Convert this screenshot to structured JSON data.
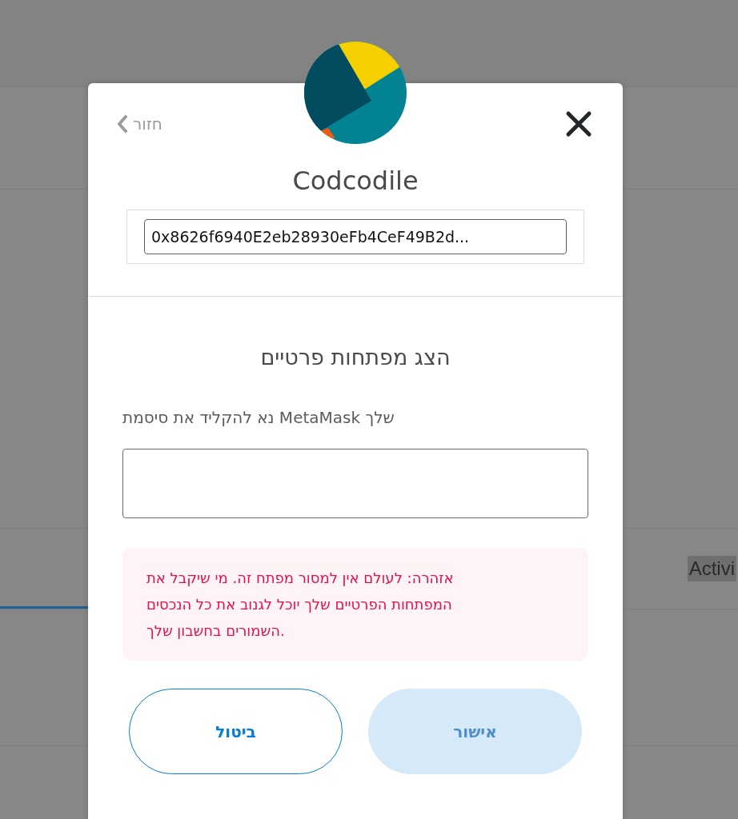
{
  "background": {
    "tabs": [
      {
        "label": "Activi",
        "selected": false
      }
    ]
  },
  "dialog": {
    "back_label": "חזור",
    "account_name": "Codcodile",
    "address": "0x8626f6940E2eb28930eFb4CeF49B2d...",
    "heading": "הצג מפתחות פרטיים",
    "password_label": "נא להקליד את סיסמת MetaMask שלך",
    "warning": "אזהרה: לעולם אין למסור מפתח זה. מי שיקבל את המפתחות הפרטיים שלך יוכל לגנוב את כל הנכסים השמורים בחשבון שלך.",
    "buttons": [
      {
        "label": "אישור",
        "kind": "primary",
        "disabled": true
      },
      {
        "label": "ביטול",
        "kind": "secondary",
        "disabled": false
      }
    ]
  }
}
